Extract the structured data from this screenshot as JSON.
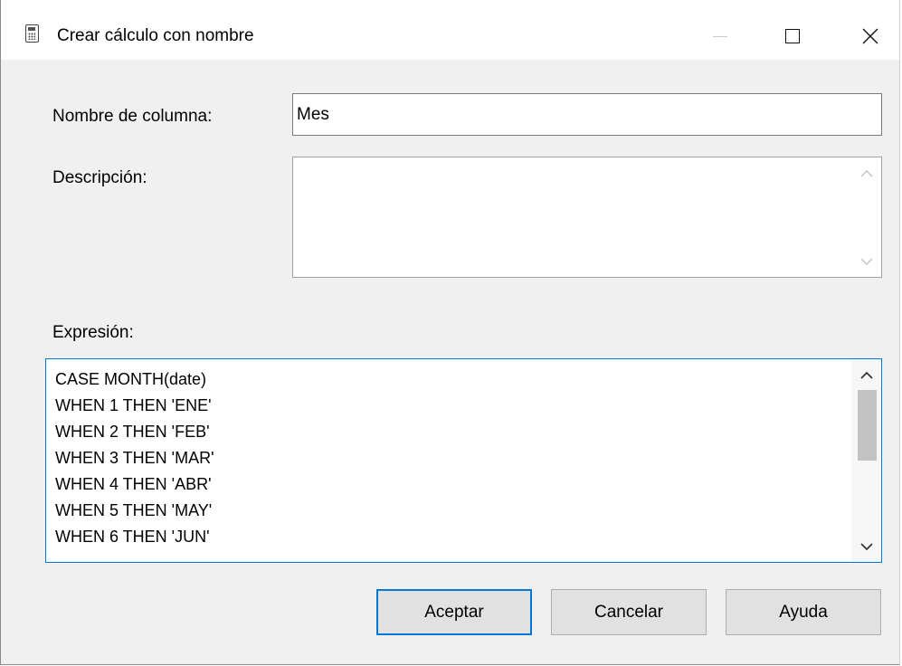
{
  "window": {
    "title": "Crear cálculo con nombre",
    "icon": "calculator-icon",
    "controls": {
      "minimize_icon": "minimize-icon",
      "maximize_icon": "maximize-icon",
      "close_icon": "close-icon"
    }
  },
  "form": {
    "column_name_label": "Nombre de columna:",
    "column_name_value": "Mes",
    "description_label": "Descripción:",
    "description_value": "",
    "expression_label": "Expresión:",
    "expression_lines": [
      "CASE MONTH(date)",
      "WHEN 1 THEN 'ENE'",
      "WHEN 2 THEN 'FEB'",
      "WHEN 3 THEN 'MAR'",
      "WHEN 4 THEN 'ABR'",
      "WHEN 5 THEN 'MAY'",
      "WHEN 6 THEN 'JUN'"
    ]
  },
  "buttons": {
    "ok": "Aceptar",
    "cancel": "Cancelar",
    "help": "Ayuda"
  },
  "colors": {
    "accent": "#0078d7",
    "dialog_background": "#f0f0f0",
    "button_background": "#e1e1e1"
  }
}
